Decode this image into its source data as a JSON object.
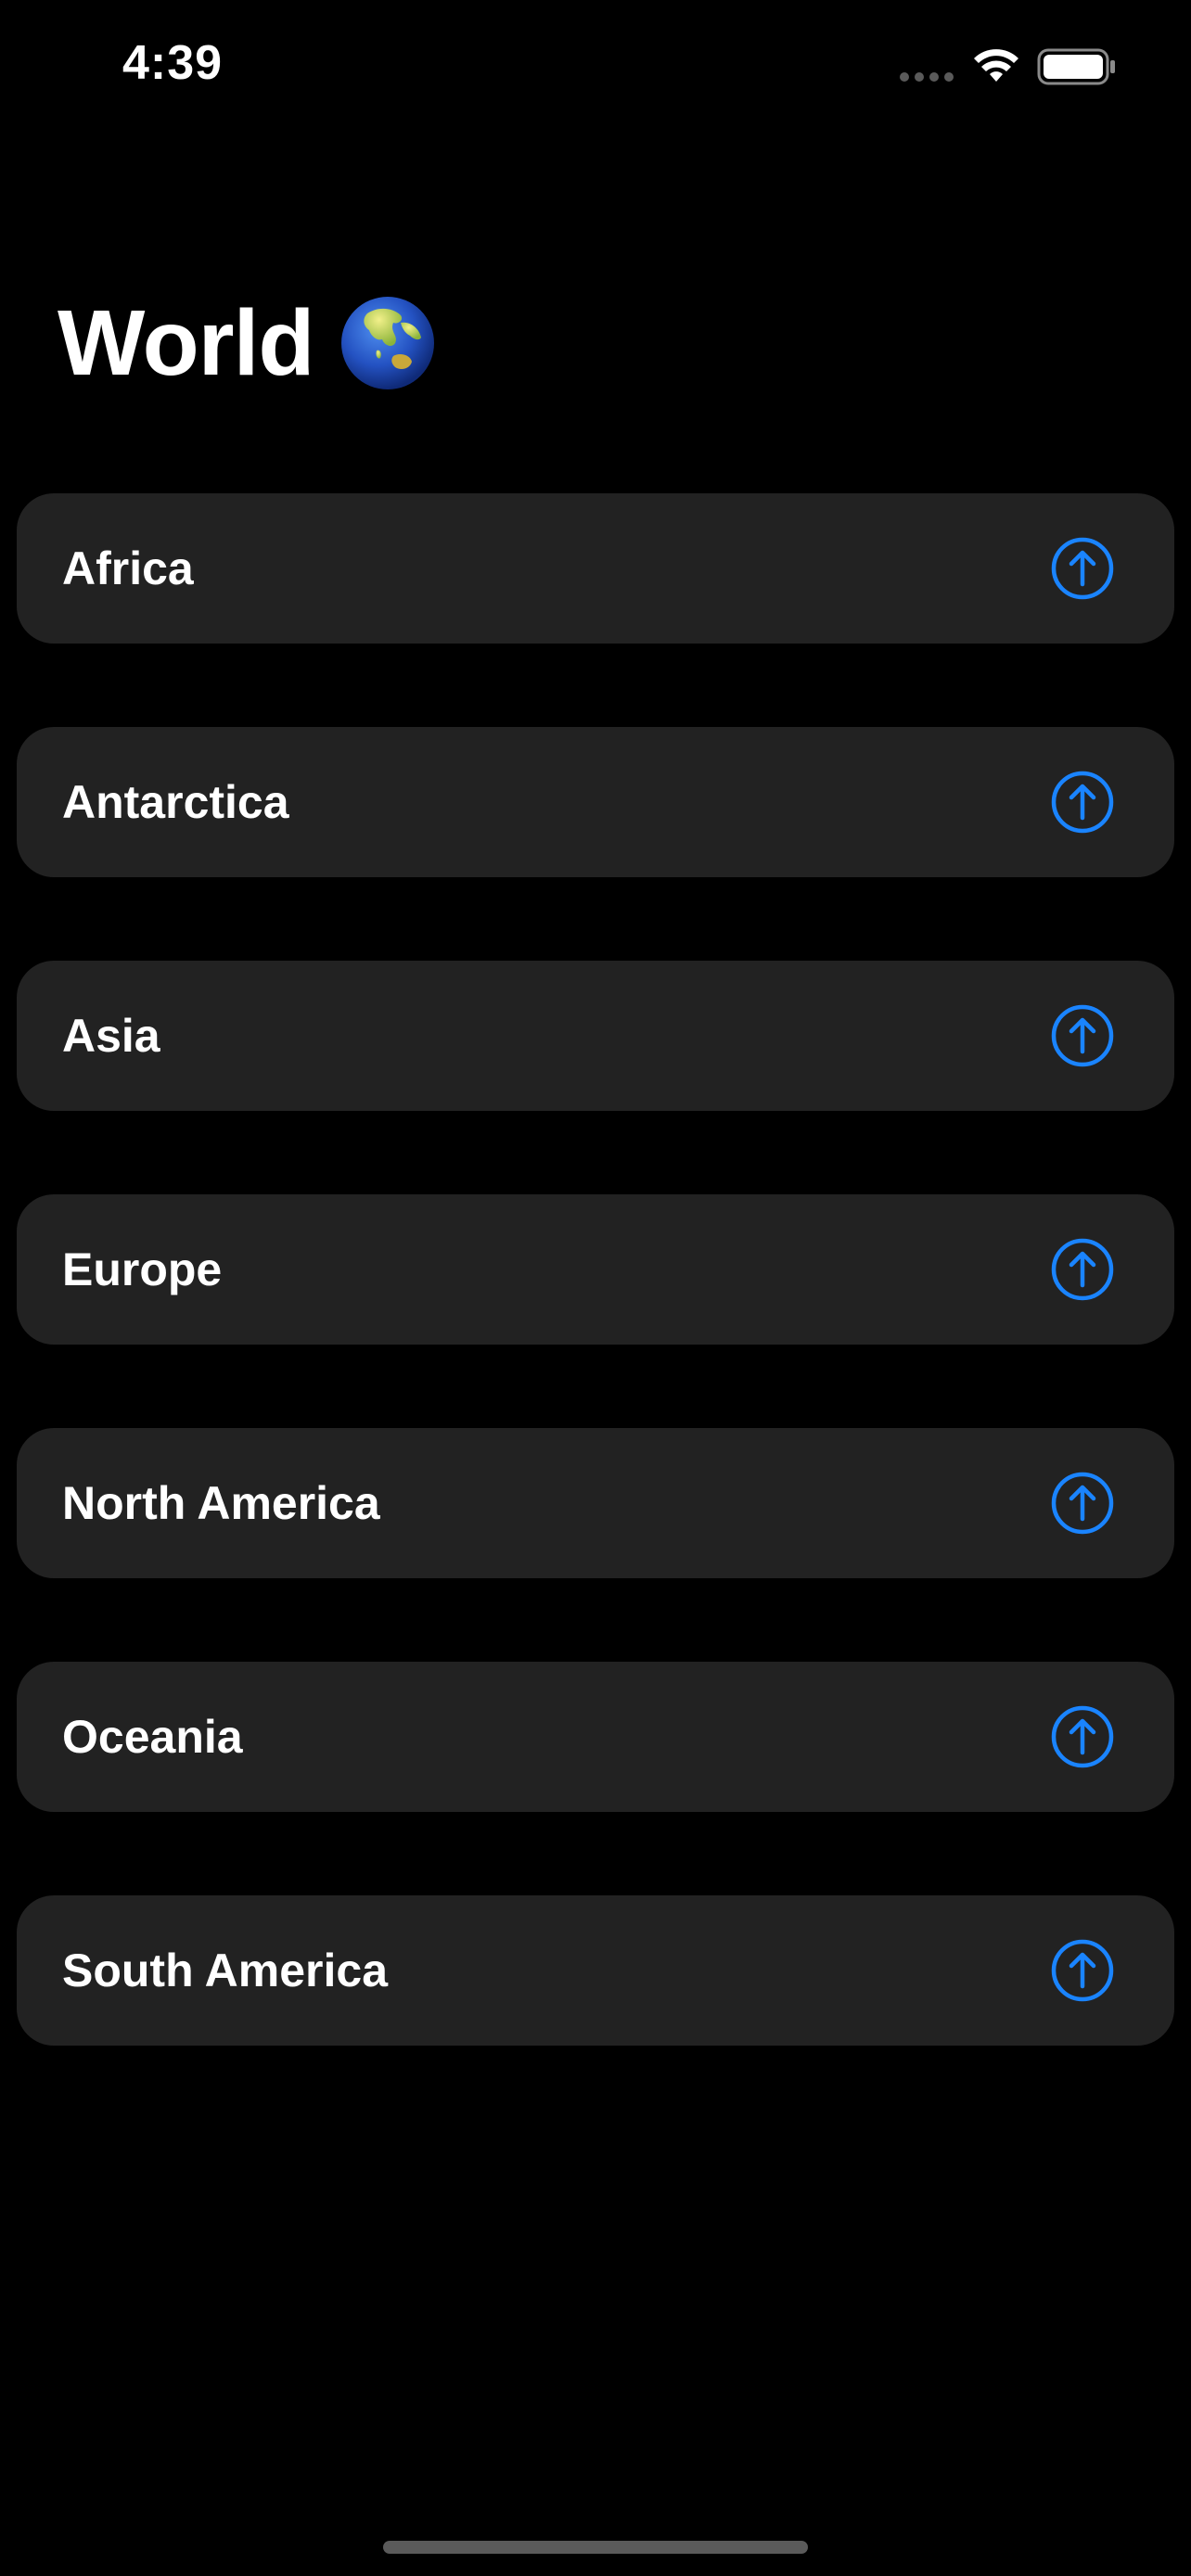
{
  "status_bar": {
    "time": "4:39",
    "icons": [
      "signal-dots-icon",
      "wifi-icon",
      "battery-icon"
    ]
  },
  "header": {
    "title": "World",
    "title_icon": "globe-icon"
  },
  "regions": [
    {
      "label": "Africa",
      "action_icon": "arrow-up-circle-icon"
    },
    {
      "label": "Antarctica",
      "action_icon": "arrow-up-circle-icon"
    },
    {
      "label": "Asia",
      "action_icon": "arrow-up-circle-icon"
    },
    {
      "label": "Europe",
      "action_icon": "arrow-up-circle-icon"
    },
    {
      "label": "North America",
      "action_icon": "arrow-up-circle-icon"
    },
    {
      "label": "Oceania",
      "action_icon": "arrow-up-circle-icon"
    },
    {
      "label": "South America",
      "action_icon": "arrow-up-circle-icon"
    }
  ],
  "colors": {
    "background": "#000000",
    "row_background": "#222222",
    "accent": "#1a84ff",
    "text": "#ffffff"
  }
}
